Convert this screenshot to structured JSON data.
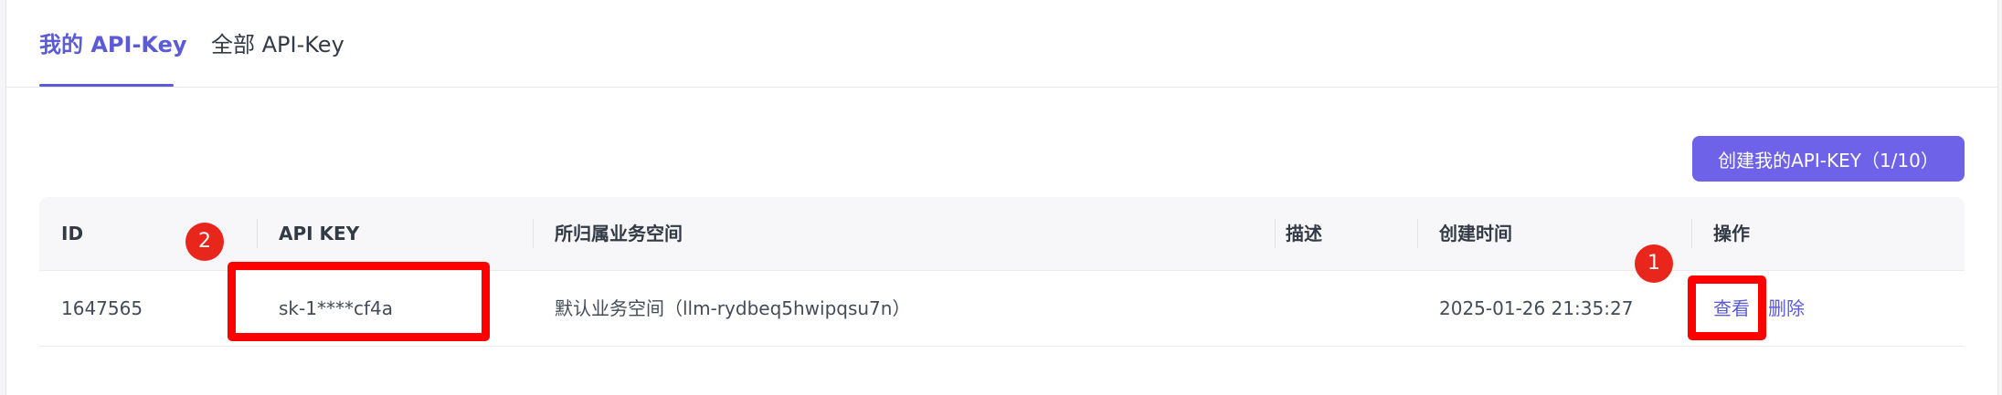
{
  "tabs": [
    {
      "label": "我的 API-Key",
      "active": true
    },
    {
      "label": "全部 API-Key",
      "active": false
    }
  ],
  "create_button": {
    "label": "创建我的API-KEY（1/10）"
  },
  "table": {
    "columns": [
      "ID",
      "API KEY",
      "所归属业务空间",
      "描述",
      "创建时间",
      "操作"
    ],
    "rows": [
      {
        "id": "1647565",
        "api_key": "sk-1****cf4a",
        "workspace": "默认业务空间（llm-rydbeq5hwipqsu7n）",
        "description": "",
        "created_at": "2025-01-26 21:35:27",
        "actions": {
          "view": "查看",
          "delete": "删除"
        }
      }
    ]
  },
  "annotations": {
    "badge_1": "1",
    "badge_2": "2"
  },
  "colors": {
    "accent": "#5b5bd6",
    "button": "#6e63e8",
    "highlight": "#ff0000"
  }
}
